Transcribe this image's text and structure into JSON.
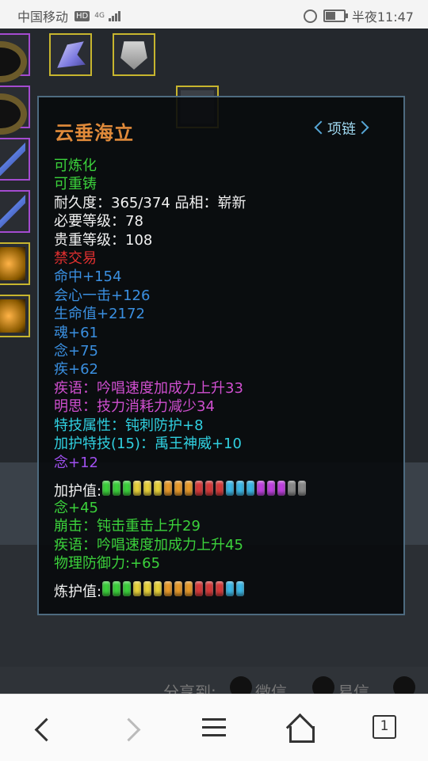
{
  "status_bar": {
    "carrier": "中国移动",
    "hd": "HD",
    "network": "4G",
    "time": "半夜11:47"
  },
  "tooltip": {
    "title": "云垂海立",
    "type_badge": "项链",
    "lines": [
      {
        "text": "可炼化",
        "color": "green"
      },
      {
        "text": "可重铸",
        "color": "green"
      },
      {
        "text": "耐久度：365/374  品相：崭新",
        "color": "white"
      },
      {
        "text": "必要等级：78",
        "color": "white"
      },
      {
        "text": "贵重等级：108",
        "color": "white"
      },
      {
        "text": "禁交易",
        "color": "red"
      },
      {
        "text": "命中+154",
        "color": "blue"
      },
      {
        "text": "会心一击+126",
        "color": "blue"
      },
      {
        "text": "生命值+2172",
        "color": "blue"
      },
      {
        "text": "魂+61",
        "color": "blue"
      },
      {
        "text": "念+75",
        "color": "blue"
      },
      {
        "text": "疾+62",
        "color": "blue"
      },
      {
        "text": "疾语：吟唱速度加成力上升33",
        "color": "magenta"
      },
      {
        "text": "明思：技力消耗力减少34",
        "color": "magenta"
      },
      {
        "text": "特技属性：钝刺防护+8",
        "color": "cyan"
      },
      {
        "text": "加护特技(15)：禹王神威+10",
        "color": "cyan"
      },
      {
        "text": "念+12",
        "color": "purple"
      }
    ],
    "protect_gauge": {
      "label": "加护值:",
      "pips": [
        "green",
        "green",
        "green",
        "yellow",
        "yellow",
        "yellow",
        "orange",
        "orange",
        "orange",
        "red",
        "red",
        "red",
        "cyan",
        "cyan",
        "cyan",
        "magenta",
        "magenta",
        "magenta",
        "gray",
        "gray"
      ]
    },
    "lines2": [
      {
        "text": "念+45",
        "color": "green"
      },
      {
        "text": "崩击：钝击重击上升29",
        "color": "green"
      },
      {
        "text": "疾语：吟唱速度加成力上升45",
        "color": "green"
      },
      {
        "text": "物理防御力:+65",
        "color": "green"
      }
    ],
    "refine_gauge": {
      "label": "炼护值:",
      "pips": [
        "green",
        "green",
        "green",
        "yellow",
        "yellow",
        "yellow",
        "orange",
        "orange",
        "orange",
        "red",
        "red",
        "red",
        "cyan",
        "cyan"
      ]
    }
  },
  "share_bar": {
    "label": "分享到:",
    "targets": [
      "微信",
      "易信"
    ]
  },
  "browser_nav": {
    "tab_count": "1"
  },
  "colors": {
    "green": "#3bd13b",
    "yellow": "#e8d23a",
    "orange": "#e89a2a",
    "red": "#d83a3a",
    "cyan": "#3ab8e8",
    "magenta": "#c040e0",
    "gray": "#8a8a8a"
  }
}
